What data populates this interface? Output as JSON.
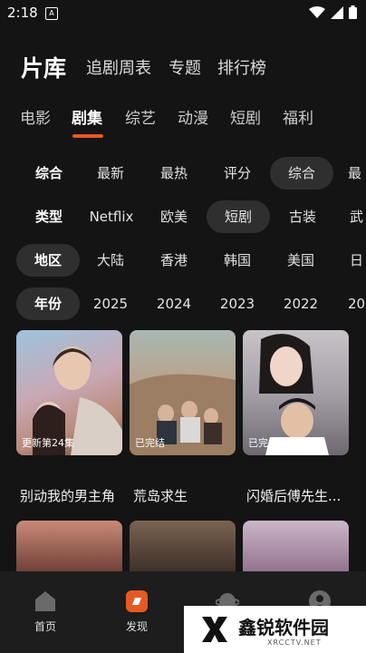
{
  "status": {
    "time": "2:18",
    "notif_letter": "A"
  },
  "topnav": {
    "title": "片库",
    "items": [
      "追剧周表",
      "专题",
      "排行榜"
    ]
  },
  "tabs": [
    "电影",
    "剧集",
    "综艺",
    "动漫",
    "短剧",
    "福利"
  ],
  "filters": {
    "sort": {
      "label": "综合",
      "options": [
        "最新",
        "最热",
        "评分",
        "综合",
        "最"
      ]
    },
    "type": {
      "label": "类型",
      "options": [
        "Netflix",
        "欧美",
        "短剧",
        "古装",
        "武"
      ]
    },
    "region": {
      "label": "地区",
      "options": [
        "大陆",
        "香港",
        "韩国",
        "美国",
        "日"
      ]
    },
    "year": {
      "label": "年份",
      "options": [
        "2025",
        "2024",
        "2023",
        "2022",
        "20"
      ]
    }
  },
  "cards": [
    {
      "title": "别动我的男主角",
      "badge": "更新第24集"
    },
    {
      "title": "荒岛求生",
      "badge": "已完结"
    },
    {
      "title": "闪婚后傅先生...",
      "badge": "已完结"
    }
  ],
  "bottom_nav": [
    {
      "label": "首页",
      "icon": "home-icon"
    },
    {
      "label": "发现",
      "icon": "discover-icon"
    },
    {
      "label": "",
      "icon": "planet-icon"
    },
    {
      "label": "",
      "icon": "profile-icon"
    }
  ],
  "watermark": {
    "text": "鑫锐软件园",
    "sub": "XRCCTV.NET"
  },
  "colors": {
    "accent": "#e55a24",
    "background": "#141414",
    "chip_selected": "#2f2f2f"
  }
}
